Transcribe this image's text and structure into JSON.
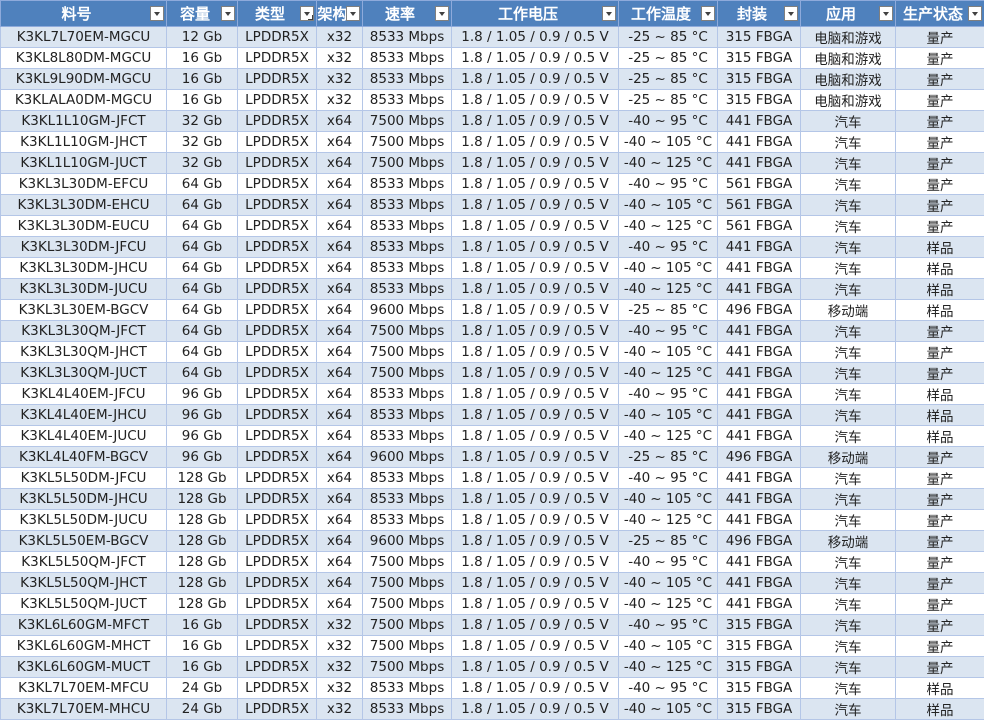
{
  "columns": [
    {
      "label": "料号",
      "filter_active": false
    },
    {
      "label": "容量",
      "filter_active": false
    },
    {
      "label": "类型",
      "filter_active": true
    },
    {
      "label": "架构",
      "filter_active": false
    },
    {
      "label": "速率",
      "filter_active": false
    },
    {
      "label": "工作电压",
      "filter_active": false
    },
    {
      "label": "工作温度",
      "filter_active": false
    },
    {
      "label": "封装",
      "filter_active": false
    },
    {
      "label": "应用",
      "filter_active": false
    },
    {
      "label": "生产状态",
      "filter_active": false
    }
  ],
  "rows": [
    [
      "K3KL7L70EM-MGCU",
      "12 Gb",
      "LPDDR5X",
      "x32",
      "8533 Mbps",
      "1.8 / 1.05 / 0.9 / 0.5 V",
      "-25 ~ 85 °C",
      "315 FBGA",
      "电脑和游戏",
      "量产"
    ],
    [
      "K3KL8L80DM-MGCU",
      "16 Gb",
      "LPDDR5X",
      "x32",
      "8533 Mbps",
      "1.8 / 1.05 / 0.9 / 0.5 V",
      "-25 ~ 85 °C",
      "315 FBGA",
      "电脑和游戏",
      "量产"
    ],
    [
      "K3KL9L90DM-MGCU",
      "16 Gb",
      "LPDDR5X",
      "x32",
      "8533 Mbps",
      "1.8 / 1.05 / 0.9 / 0.5 V",
      "-25 ~ 85 °C",
      "315 FBGA",
      "电脑和游戏",
      "量产"
    ],
    [
      "K3KLALA0DM-MGCU",
      "16 Gb",
      "LPDDR5X",
      "x32",
      "8533 Mbps",
      "1.8 / 1.05 / 0.9 / 0.5 V",
      "-25 ~ 85 °C",
      "315 FBGA",
      "电脑和游戏",
      "量产"
    ],
    [
      "K3KL1L10GM-JFCT",
      "32 Gb",
      "LPDDR5X",
      "x64",
      "7500 Mbps",
      "1.8 / 1.05 / 0.9 / 0.5 V",
      "-40 ~ 95 °C",
      "441 FBGA",
      "汽车",
      "量产"
    ],
    [
      "K3KL1L10GM-JHCT",
      "32 Gb",
      "LPDDR5X",
      "x64",
      "7500 Mbps",
      "1.8 / 1.05 / 0.9 / 0.5 V",
      "-40 ~ 105 °C",
      "441 FBGA",
      "汽车",
      "量产"
    ],
    [
      "K3KL1L10GM-JUCT",
      "32 Gb",
      "LPDDR5X",
      "x64",
      "7500 Mbps",
      "1.8 / 1.05 / 0.9 / 0.5 V",
      "-40 ~ 125 °C",
      "441 FBGA",
      "汽车",
      "量产"
    ],
    [
      "K3KL3L30DM-EFCU",
      "64 Gb",
      "LPDDR5X",
      "x64",
      "8533 Mbps",
      "1.8 / 1.05 / 0.9 / 0.5 V",
      "-40 ~ 95 °C",
      "561 FBGA",
      "汽车",
      "量产"
    ],
    [
      "K3KL3L30DM-EHCU",
      "64 Gb",
      "LPDDR5X",
      "x64",
      "8533 Mbps",
      "1.8 / 1.05 / 0.9 / 0.5 V",
      "-40 ~ 105 °C",
      "561 FBGA",
      "汽车",
      "量产"
    ],
    [
      "K3KL3L30DM-EUCU",
      "64 Gb",
      "LPDDR5X",
      "x64",
      "8533 Mbps",
      "1.8 / 1.05 / 0.9 / 0.5 V",
      "-40 ~ 125 °C",
      "561 FBGA",
      "汽车",
      "量产"
    ],
    [
      "K3KL3L30DM-JFCU",
      "64 Gb",
      "LPDDR5X",
      "x64",
      "8533 Mbps",
      "1.8 / 1.05 / 0.9 / 0.5 V",
      "-40 ~ 95 °C",
      "441 FBGA",
      "汽车",
      "样品"
    ],
    [
      "K3KL3L30DM-JHCU",
      "64 Gb",
      "LPDDR5X",
      "x64",
      "8533 Mbps",
      "1.8 / 1.05 / 0.9 / 0.5 V",
      "-40 ~ 105 °C",
      "441 FBGA",
      "汽车",
      "样品"
    ],
    [
      "K3KL3L30DM-JUCU",
      "64 Gb",
      "LPDDR5X",
      "x64",
      "8533 Mbps",
      "1.8 / 1.05 / 0.9 / 0.5 V",
      "-40 ~ 125 °C",
      "441 FBGA",
      "汽车",
      "样品"
    ],
    [
      "K3KL3L30EM-BGCV",
      "64 Gb",
      "LPDDR5X",
      "x64",
      "9600 Mbps",
      "1.8 / 1.05 / 0.9 / 0.5 V",
      "-25 ~ 85 °C",
      "496 FBGA",
      "移动端",
      "样品"
    ],
    [
      "K3KL3L30QM-JFCT",
      "64 Gb",
      "LPDDR5X",
      "x64",
      "7500 Mbps",
      "1.8 / 1.05 / 0.9 / 0.5 V",
      "-40 ~ 95 °C",
      "441 FBGA",
      "汽车",
      "量产"
    ],
    [
      "K3KL3L30QM-JHCT",
      "64 Gb",
      "LPDDR5X",
      "x64",
      "7500 Mbps",
      "1.8 / 1.05 / 0.9 / 0.5 V",
      "-40 ~ 105 °C",
      "441 FBGA",
      "汽车",
      "量产"
    ],
    [
      "K3KL3L30QM-JUCT",
      "64 Gb",
      "LPDDR5X",
      "x64",
      "7500 Mbps",
      "1.8 / 1.05 / 0.9 / 0.5 V",
      "-40 ~ 125 °C",
      "441 FBGA",
      "汽车",
      "量产"
    ],
    [
      "K3KL4L40EM-JFCU",
      "96 Gb",
      "LPDDR5X",
      "x64",
      "8533 Mbps",
      "1.8 / 1.05 / 0.9 / 0.5 V",
      "-40 ~ 95 °C",
      "441 FBGA",
      "汽车",
      "样品"
    ],
    [
      "K3KL4L40EM-JHCU",
      "96 Gb",
      "LPDDR5X",
      "x64",
      "8533 Mbps",
      "1.8 / 1.05 / 0.9 / 0.5 V",
      "-40 ~ 105 °C",
      "441 FBGA",
      "汽车",
      "样品"
    ],
    [
      "K3KL4L40EM-JUCU",
      "96 Gb",
      "LPDDR5X",
      "x64",
      "8533 Mbps",
      "1.8 / 1.05 / 0.9 / 0.5 V",
      "-40 ~ 125 °C",
      "441 FBGA",
      "汽车",
      "样品"
    ],
    [
      "K3KL4L40FM-BGCV",
      "96 Gb",
      "LPDDR5X",
      "x64",
      "9600 Mbps",
      "1.8 / 1.05 / 0.9 / 0.5 V",
      "-25 ~ 85 °C",
      "496 FBGA",
      "移动端",
      "量产"
    ],
    [
      "K3KL5L50DM-JFCU",
      "128 Gb",
      "LPDDR5X",
      "x64",
      "8533 Mbps",
      "1.8 / 1.05 / 0.9 / 0.5 V",
      "-40 ~ 95 °C",
      "441 FBGA",
      "汽车",
      "量产"
    ],
    [
      "K3KL5L50DM-JHCU",
      "128 Gb",
      "LPDDR5X",
      "x64",
      "8533 Mbps",
      "1.8 / 1.05 / 0.9 / 0.5 V",
      "-40 ~ 105 °C",
      "441 FBGA",
      "汽车",
      "量产"
    ],
    [
      "K3KL5L50DM-JUCU",
      "128 Gb",
      "LPDDR5X",
      "x64",
      "8533 Mbps",
      "1.8 / 1.05 / 0.9 / 0.5 V",
      "-40 ~ 125 °C",
      "441 FBGA",
      "汽车",
      "量产"
    ],
    [
      "K3KL5L50EM-BGCV",
      "128 Gb",
      "LPDDR5X",
      "x64",
      "9600 Mbps",
      "1.8 / 1.05 / 0.9 / 0.5 V",
      "-25 ~ 85 °C",
      "496 FBGA",
      "移动端",
      "量产"
    ],
    [
      "K3KL5L50QM-JFCT",
      "128 Gb",
      "LPDDR5X",
      "x64",
      "7500 Mbps",
      "1.8 / 1.05 / 0.9 / 0.5 V",
      "-40 ~ 95 °C",
      "441 FBGA",
      "汽车",
      "量产"
    ],
    [
      "K3KL5L50QM-JHCT",
      "128 Gb",
      "LPDDR5X",
      "x64",
      "7500 Mbps",
      "1.8 / 1.05 / 0.9 / 0.5 V",
      "-40 ~ 105 °C",
      "441 FBGA",
      "汽车",
      "量产"
    ],
    [
      "K3KL5L50QM-JUCT",
      "128 Gb",
      "LPDDR5X",
      "x64",
      "7500 Mbps",
      "1.8 / 1.05 / 0.9 / 0.5 V",
      "-40 ~ 125 °C",
      "441 FBGA",
      "汽车",
      "量产"
    ],
    [
      "K3KL6L60GM-MFCT",
      "16 Gb",
      "LPDDR5X",
      "x32",
      "7500 Mbps",
      "1.8 / 1.05 / 0.9 / 0.5 V",
      "-40 ~ 95 °C",
      "315 FBGA",
      "汽车",
      "量产"
    ],
    [
      "K3KL6L60GM-MHCT",
      "16 Gb",
      "LPDDR5X",
      "x32",
      "7500 Mbps",
      "1.8 / 1.05 / 0.9 / 0.5 V",
      "-40 ~ 105 °C",
      "315 FBGA",
      "汽车",
      "量产"
    ],
    [
      "K3KL6L60GM-MUCT",
      "16 Gb",
      "LPDDR5X",
      "x32",
      "7500 Mbps",
      "1.8 / 1.05 / 0.9 / 0.5 V",
      "-40 ~ 125 °C",
      "315 FBGA",
      "汽车",
      "量产"
    ],
    [
      "K3KL7L70EM-MFCU",
      "24 Gb",
      "LPDDR5X",
      "x32",
      "8533 Mbps",
      "1.8 / 1.05 / 0.9 / 0.5 V",
      "-40 ~ 95 °C",
      "315 FBGA",
      "汽车",
      "样品"
    ],
    [
      "K3KL7L70EM-MHCU",
      "24 Gb",
      "LPDDR5X",
      "x32",
      "8533 Mbps",
      "1.8 / 1.05 / 0.9 / 0.5 V",
      "-40 ~ 105 °C",
      "315 FBGA",
      "汽车",
      "样品"
    ]
  ]
}
